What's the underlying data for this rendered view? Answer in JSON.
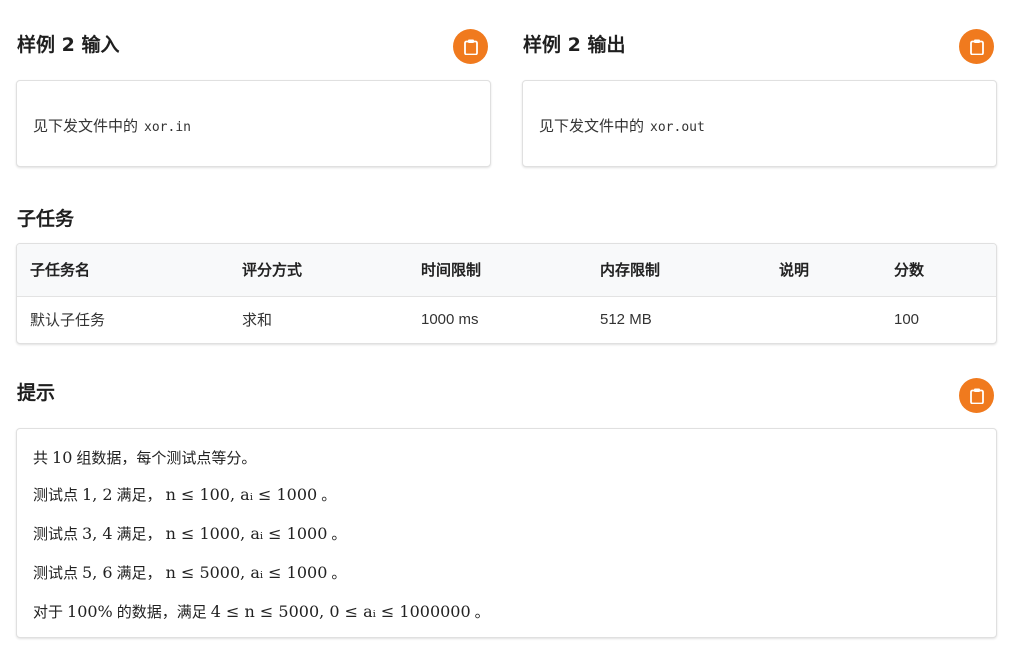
{
  "sample2_input": {
    "title": "样例 2 输入",
    "text": "见下发文件中的",
    "code": "xor.in"
  },
  "sample2_output": {
    "title": "样例 2 输出",
    "text": "见下发文件中的",
    "code": "xor.out"
  },
  "subtasks": {
    "title": "子任务",
    "headers": [
      "子任务名",
      "评分方式",
      "时间限制",
      "内存限制",
      "说明",
      "分数"
    ],
    "rows": [
      [
        "默认子任务",
        "求和",
        "1000 ms",
        "512 MB",
        "",
        "100"
      ]
    ]
  },
  "hint": {
    "title": "提示",
    "lines": [
      {
        "pre": "共",
        "math": "10",
        "post": "组数据，每个测试点等分。"
      },
      {
        "pre": "测试点",
        "math": "1, 2",
        "post": "满足，",
        "math2": "n ≤ 100, aᵢ ≤ 1000",
        "end": "。"
      },
      {
        "pre": "测试点",
        "math": "3, 4",
        "post": "满足，",
        "math2": "n ≤ 1000, aᵢ ≤ 1000",
        "end": "。"
      },
      {
        "pre": "测试点",
        "math": "5, 6",
        "post": "满足，",
        "math2": "n ≤ 5000, aᵢ ≤ 1000",
        "end": "。"
      },
      {
        "pre": "对于",
        "math": "100%",
        "post": "的数据，满足",
        "math2": "4 ≤ n ≤ 5000, 0 ≤ aᵢ ≤ 1000000",
        "end": "。"
      }
    ]
  },
  "icons": {
    "copy": "clipboard-icon"
  },
  "colors": {
    "accent": "#f07a1e"
  }
}
